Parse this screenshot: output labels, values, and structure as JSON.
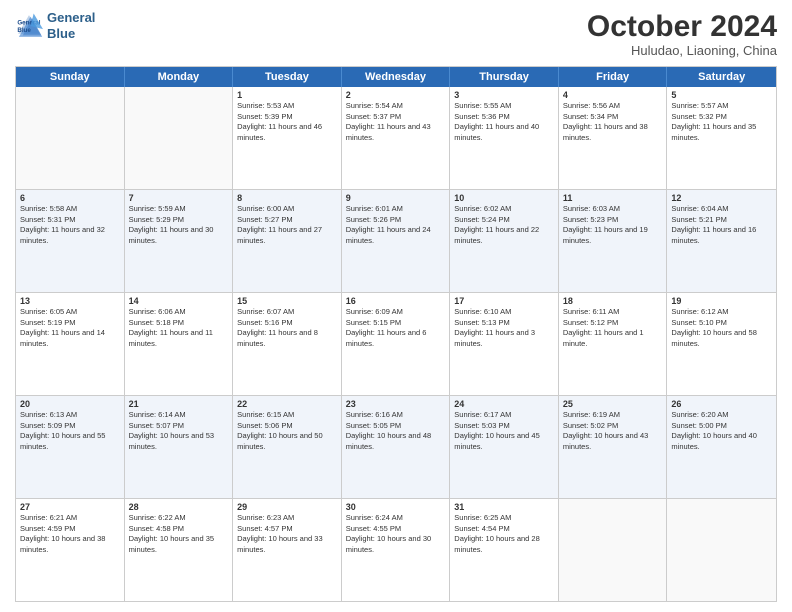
{
  "header": {
    "logo_line1": "General",
    "logo_line2": "Blue",
    "month": "October 2024",
    "location": "Huludao, Liaoning, China"
  },
  "days_of_week": [
    "Sunday",
    "Monday",
    "Tuesday",
    "Wednesday",
    "Thursday",
    "Friday",
    "Saturday"
  ],
  "rows": [
    [
      {
        "day": "",
        "info": ""
      },
      {
        "day": "",
        "info": ""
      },
      {
        "day": "1",
        "info": "Sunrise: 5:53 AM\nSunset: 5:39 PM\nDaylight: 11 hours and 46 minutes."
      },
      {
        "day": "2",
        "info": "Sunrise: 5:54 AM\nSunset: 5:37 PM\nDaylight: 11 hours and 43 minutes."
      },
      {
        "day": "3",
        "info": "Sunrise: 5:55 AM\nSunset: 5:36 PM\nDaylight: 11 hours and 40 minutes."
      },
      {
        "day": "4",
        "info": "Sunrise: 5:56 AM\nSunset: 5:34 PM\nDaylight: 11 hours and 38 minutes."
      },
      {
        "day": "5",
        "info": "Sunrise: 5:57 AM\nSunset: 5:32 PM\nDaylight: 11 hours and 35 minutes."
      }
    ],
    [
      {
        "day": "6",
        "info": "Sunrise: 5:58 AM\nSunset: 5:31 PM\nDaylight: 11 hours and 32 minutes."
      },
      {
        "day": "7",
        "info": "Sunrise: 5:59 AM\nSunset: 5:29 PM\nDaylight: 11 hours and 30 minutes."
      },
      {
        "day": "8",
        "info": "Sunrise: 6:00 AM\nSunset: 5:27 PM\nDaylight: 11 hours and 27 minutes."
      },
      {
        "day": "9",
        "info": "Sunrise: 6:01 AM\nSunset: 5:26 PM\nDaylight: 11 hours and 24 minutes."
      },
      {
        "day": "10",
        "info": "Sunrise: 6:02 AM\nSunset: 5:24 PM\nDaylight: 11 hours and 22 minutes."
      },
      {
        "day": "11",
        "info": "Sunrise: 6:03 AM\nSunset: 5:23 PM\nDaylight: 11 hours and 19 minutes."
      },
      {
        "day": "12",
        "info": "Sunrise: 6:04 AM\nSunset: 5:21 PM\nDaylight: 11 hours and 16 minutes."
      }
    ],
    [
      {
        "day": "13",
        "info": "Sunrise: 6:05 AM\nSunset: 5:19 PM\nDaylight: 11 hours and 14 minutes."
      },
      {
        "day": "14",
        "info": "Sunrise: 6:06 AM\nSunset: 5:18 PM\nDaylight: 11 hours and 11 minutes."
      },
      {
        "day": "15",
        "info": "Sunrise: 6:07 AM\nSunset: 5:16 PM\nDaylight: 11 hours and 8 minutes."
      },
      {
        "day": "16",
        "info": "Sunrise: 6:09 AM\nSunset: 5:15 PM\nDaylight: 11 hours and 6 minutes."
      },
      {
        "day": "17",
        "info": "Sunrise: 6:10 AM\nSunset: 5:13 PM\nDaylight: 11 hours and 3 minutes."
      },
      {
        "day": "18",
        "info": "Sunrise: 6:11 AM\nSunset: 5:12 PM\nDaylight: 11 hours and 1 minute."
      },
      {
        "day": "19",
        "info": "Sunrise: 6:12 AM\nSunset: 5:10 PM\nDaylight: 10 hours and 58 minutes."
      }
    ],
    [
      {
        "day": "20",
        "info": "Sunrise: 6:13 AM\nSunset: 5:09 PM\nDaylight: 10 hours and 55 minutes."
      },
      {
        "day": "21",
        "info": "Sunrise: 6:14 AM\nSunset: 5:07 PM\nDaylight: 10 hours and 53 minutes."
      },
      {
        "day": "22",
        "info": "Sunrise: 6:15 AM\nSunset: 5:06 PM\nDaylight: 10 hours and 50 minutes."
      },
      {
        "day": "23",
        "info": "Sunrise: 6:16 AM\nSunset: 5:05 PM\nDaylight: 10 hours and 48 minutes."
      },
      {
        "day": "24",
        "info": "Sunrise: 6:17 AM\nSunset: 5:03 PM\nDaylight: 10 hours and 45 minutes."
      },
      {
        "day": "25",
        "info": "Sunrise: 6:19 AM\nSunset: 5:02 PM\nDaylight: 10 hours and 43 minutes."
      },
      {
        "day": "26",
        "info": "Sunrise: 6:20 AM\nSunset: 5:00 PM\nDaylight: 10 hours and 40 minutes."
      }
    ],
    [
      {
        "day": "27",
        "info": "Sunrise: 6:21 AM\nSunset: 4:59 PM\nDaylight: 10 hours and 38 minutes."
      },
      {
        "day": "28",
        "info": "Sunrise: 6:22 AM\nSunset: 4:58 PM\nDaylight: 10 hours and 35 minutes."
      },
      {
        "day": "29",
        "info": "Sunrise: 6:23 AM\nSunset: 4:57 PM\nDaylight: 10 hours and 33 minutes."
      },
      {
        "day": "30",
        "info": "Sunrise: 6:24 AM\nSunset: 4:55 PM\nDaylight: 10 hours and 30 minutes."
      },
      {
        "day": "31",
        "info": "Sunrise: 6:25 AM\nSunset: 4:54 PM\nDaylight: 10 hours and 28 minutes."
      },
      {
        "day": "",
        "info": ""
      },
      {
        "day": "",
        "info": ""
      }
    ]
  ]
}
